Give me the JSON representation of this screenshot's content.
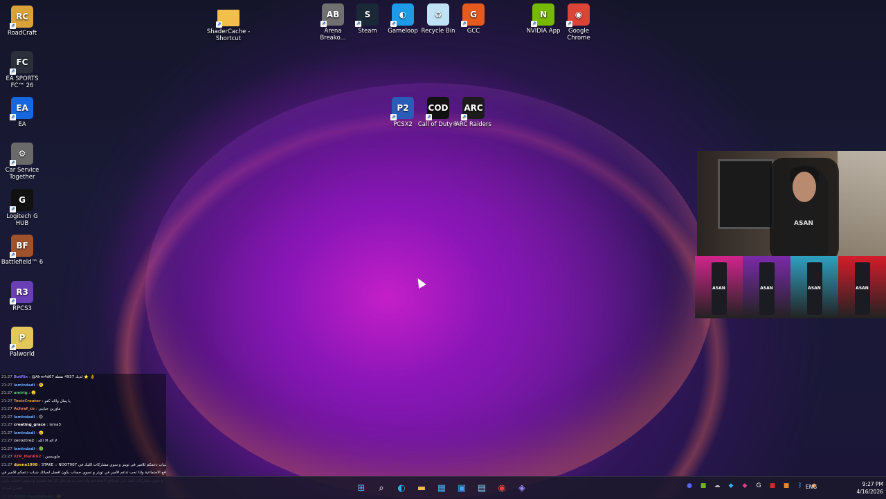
{
  "desktop_icons": [
    {
      "id": "roadcraft",
      "label": "RoadCraft",
      "icon": "roadcraft-logo-icon",
      "color": "#d9a33a"
    },
    {
      "id": "ea-sports-fc",
      "label": "EA SPORTS FC™ 26",
      "icon": "ea-fc-icon",
      "color": "#2a2f3a"
    },
    {
      "id": "ea",
      "label": "EA",
      "icon": "ea-logo-icon",
      "color": "#1668e0"
    },
    {
      "id": "car-service-together",
      "label": "Car Service Together",
      "icon": "car-service-icon",
      "color": "#6a6a6a"
    },
    {
      "id": "logitech-g-hub",
      "label": "Logitech G HUB",
      "icon": "logitech-g-icon",
      "color": "#111111"
    },
    {
      "id": "battlefield-6",
      "label": "Battlefield™ 6",
      "icon": "battlefield-icon",
      "color": "#a0522d"
    },
    {
      "id": "rpcs3",
      "label": "RPCS3",
      "icon": "rpcs3-icon",
      "color": "#6a3fb5"
    },
    {
      "id": "palworld",
      "label": "Palworld",
      "icon": "palworld-icon",
      "color": "#e3c75a"
    },
    {
      "id": "shadercache",
      "label": "ShaderCache - Shortcut",
      "icon": "folder-icon",
      "color": "#f2c04a"
    },
    {
      "id": "arena-breakout",
      "label": "Arena Breako...",
      "icon": "arena-breakout-icon",
      "color": "#707070"
    },
    {
      "id": "steam",
      "label": "Steam",
      "icon": "steam-icon",
      "color": "#1b2838"
    },
    {
      "id": "gameloop",
      "label": "Gameloop",
      "icon": "gameloop-icon",
      "color": "#1e9be8"
    },
    {
      "id": "recycle-bin",
      "label": "Recycle Bin",
      "icon": "recycle-bin-icon",
      "color": "#bfe3f5"
    },
    {
      "id": "gcc",
      "label": "GCC",
      "icon": "gcc-icon",
      "color": "#e65a1e"
    },
    {
      "id": "nvidia-app",
      "label": "NVIDIA App",
      "icon": "nvidia-icon",
      "color": "#76b900"
    },
    {
      "id": "google-chrome",
      "label": "Google Chrome",
      "icon": "chrome-icon",
      "color": "#db4437"
    },
    {
      "id": "pcsx2",
      "label": "PCSX2",
      "icon": "pcsx2-icon",
      "color": "#2b5db8"
    },
    {
      "id": "call-of-duty",
      "label": "Call of Duty®",
      "icon": "call-of-duty-icon",
      "color": "#111111"
    },
    {
      "id": "arc-raiders",
      "label": "ARC Raiders",
      "icon": "arc-raiders-icon",
      "color": "#1c1c1c"
    }
  ],
  "webcam": {
    "shirt_text": "ASAN"
  },
  "cans": [
    {
      "brand": "ASAN",
      "color": "#d1248a"
    },
    {
      "brand": "ASAN",
      "color": "#7a2aa8"
    },
    {
      "brand": "ASAN",
      "color": "#2fa0c0"
    },
    {
      "brand": "ASAN",
      "color": "#d41c2a"
    }
  ],
  "chat": [
    {
      "time": "21:27",
      "user": "BotRix",
      "user_color": "#8a7cff",
      "text": ": @Ahm4d07 لديك 4937 نقطة ⭐ 👌"
    },
    {
      "time": "21:27",
      "user": "lamindadi",
      "user_color": "#6aa9ff",
      "text": ": 🙂"
    },
    {
      "time": "21:27",
      "user": "amirig",
      "user_color": "#4fd26a",
      "text": ": 🙂"
    },
    {
      "time": "21:27",
      "user": "ToxicCreator",
      "user_color": "#e0a030",
      "text": ": يا يطل والله كفو"
    },
    {
      "time": "21:27",
      "user": "Achraf_co",
      "user_color": "#ff8a5a",
      "text": ": ماورين حبايبي"
    },
    {
      "time": "21:27",
      "user": "lamindadi",
      "user_color": "#6aa9ff",
      "text": ": 😊"
    },
    {
      "time": "21:27",
      "user": "creating_grace",
      "user_color": "#ffffff",
      "text": ": isma3"
    },
    {
      "time": "21:27",
      "user": "lamindadi",
      "user_color": "#6aa9ff",
      "text": ": 🙂"
    },
    {
      "time": "21:27",
      "user": "zeroztre2",
      "user_color": "#c0c0c0",
      "text": ": لا اله الا الله"
    },
    {
      "time": "21:27",
      "user": "lamindadi",
      "user_color": "#6aa9ff",
      "text": ": 🟢"
    },
    {
      "time": "21:27",
      "user": "ATR_MahR62",
      "user_color": "#e03a3a",
      "text": ": ملوبيسين"
    },
    {
      "time": "21:27",
      "user": "dpena1998",
      "user_color": "#ffd24a",
      "text": ": STAKE :: NOOT007 شباب دعمكم للامير في تويتر و سوي مشاركات الليك في ( x ) تويتر"
    },
    {
      "time": "",
      "user": "",
      "user_color": "#ffffff",
      "text": "المواقع الاجتماعية واذا تحب تدعم الامير في تويتر و تسوي حساب بكون افضل لحياتك شباب دعمكم للامير في"
    },
    {
      "time": "",
      "user": "",
      "user_color": "#ffffff",
      "text": "و سوي مشاركات الليك في المواقع الاجتماعية واذا تحب تدعم على الرابط المثبت و تسوي حساب بكون ( x ) تويتر"
    },
    {
      "time": "",
      "user": "",
      "user_color": "#ffffff",
      "text": "افضل لحياتك"
    },
    {
      "time": "21:27",
      "user": "ATRO_MustfaRaad",
      "user_color": "#4fd26a",
      "text": ": 🙂"
    }
  ],
  "taskbar": {
    "pinned": [
      {
        "id": "start",
        "icon": "windows-start-icon",
        "glyph": "⊞",
        "color": "#4cc2ff"
      },
      {
        "id": "search",
        "icon": "search-icon",
        "glyph": "⌕",
        "color": "#ffffff"
      },
      {
        "id": "edge",
        "icon": "edge-icon",
        "glyph": "◐",
        "color": "#2fb0e8"
      },
      {
        "id": "file-explorer",
        "icon": "folder-icon",
        "glyph": "▬",
        "color": "#f2c04a"
      },
      {
        "id": "store",
        "icon": "store-icon",
        "glyph": "▦",
        "color": "#4aa3e8"
      },
      {
        "id": "photos",
        "icon": "photos-icon",
        "glyph": "▣",
        "color": "#4aa3e8"
      },
      {
        "id": "control-panel",
        "icon": "control-panel-icon",
        "glyph": "▤",
        "color": "#7ec8f0"
      },
      {
        "id": "chrome",
        "icon": "chrome-icon",
        "glyph": "◉",
        "color": "#e0453a"
      },
      {
        "id": "app-9",
        "icon": "stream-app-icon",
        "glyph": "◈",
        "color": "#9a8cff"
      }
    ],
    "tray": [
      {
        "icon": "discord-icon",
        "glyph": "●",
        "color": "#5865f2"
      },
      {
        "icon": "nvidia-tray-icon",
        "glyph": "■",
        "color": "#76b900"
      },
      {
        "icon": "cloud-icon",
        "glyph": "☁",
        "color": "#bbbbbb"
      },
      {
        "icon": "tray-app-icon",
        "glyph": "◆",
        "color": "#2fb0e8"
      },
      {
        "icon": "tray-app-pink-icon",
        "glyph": "◆",
        "color": "#e0408a"
      },
      {
        "icon": "logitech-tray-icon",
        "glyph": "G",
        "color": "#ffffff"
      },
      {
        "icon": "tray-red-icon",
        "glyph": "■",
        "color": "#d42a2a"
      },
      {
        "icon": "tray-orange-icon",
        "glyph": "■",
        "color": "#e38a2a"
      },
      {
        "icon": "bluetooth-icon",
        "glyph": "ᛒ",
        "color": "#4cc2ff"
      },
      {
        "icon": "tray-app-orange-icon",
        "glyph": "◆",
        "color": "#f0803a"
      }
    ],
    "language": "ENG",
    "time": "9:27 PM",
    "date": "4/16/2026"
  }
}
